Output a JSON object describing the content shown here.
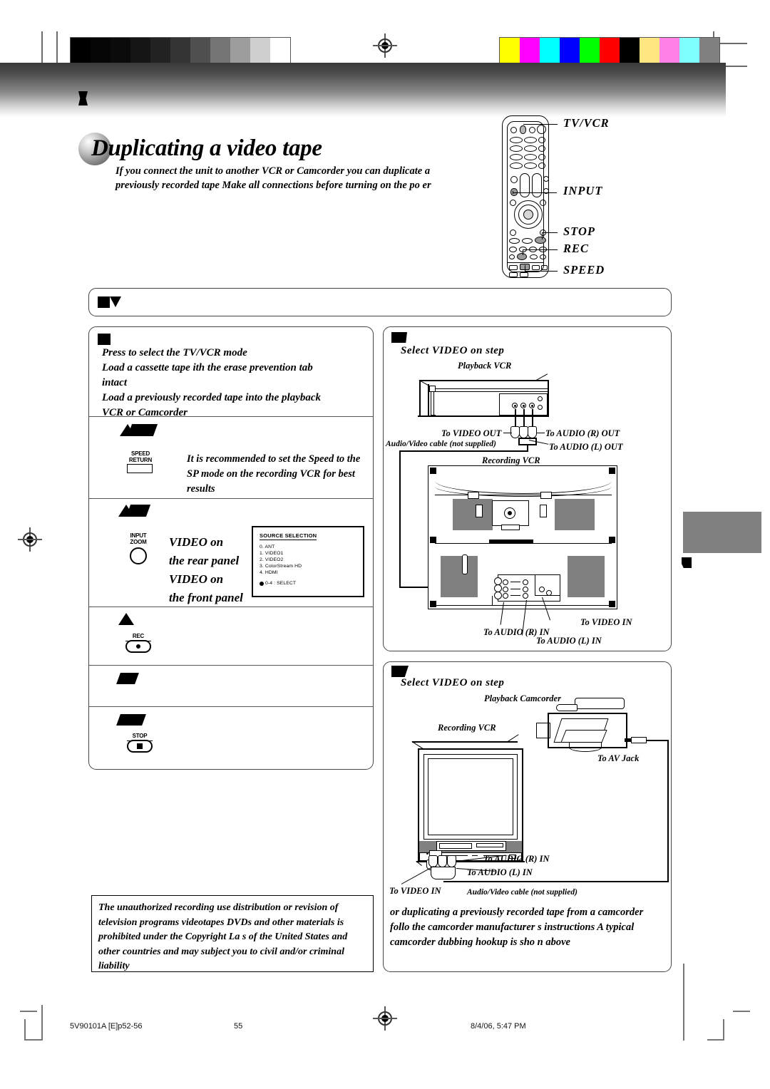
{
  "page": {
    "title": "Duplicating a video tape",
    "lead": "If you connect the unit to another VCR or Camcorder  you can duplicate a previously recorded tape  Make all connections before turning on the po  er"
  },
  "remote": {
    "callouts": [
      {
        "label": "TV/VCR"
      },
      {
        "label": "INPUT"
      },
      {
        "label": "STOP"
      },
      {
        "label": "REC"
      },
      {
        "label": "SPEED"
      }
    ]
  },
  "steps": {
    "step1": {
      "lines": [
        "Press            to select the TV/VCR mode",
        "Load a cassette tape   ith the erase prevention tab",
        "intact",
        "Load a previously recorded tape into the playback",
        "VCR or Camcorder"
      ]
    },
    "step2": {
      "key_label_line1": "SPEED",
      "key_label_line2": "RETURN",
      "text": "It is recommended to set the Speed to the SP mode on the recording VCR for best results"
    },
    "step3": {
      "key_label_line1": "INPUT",
      "key_label_line2": "ZOOM",
      "lines": [
        "VIDEO    on",
        "the rear panel",
        "VIDEO    on",
        "the front panel"
      ],
      "osd": {
        "title": "SOURCE SELECTION",
        "items": [
          "0.  ANT",
          "1.  VIDEO1",
          "2.  VIDEO2",
          "3.  ColorStream HD",
          "4.  HDMI"
        ],
        "footer": "0-4 : SELECT"
      }
    },
    "step4": {
      "key_label": "REC"
    },
    "step5": {
      "key_label": ""
    },
    "step6": {
      "key_label": "STOP"
    }
  },
  "copyright_notice": "The unauthorized recording  use  distribution  or revision of television programs  videotapes  DVDs and other materials is prohibited under the Copyright La  s of the United States and other countries  and may subject you to civil and/or criminal liability",
  "diagram_vcr": {
    "heading": "Select  VIDEO     on step",
    "playback_label": "Playback VCR",
    "recording_label": "Recording VCR",
    "cable_label": "Audio/Video cable (not supplied)",
    "to_video_out": "To VIDEO OUT",
    "to_audio_r_out": "To AUDIO (R) OUT",
    "to_audio_l_out": "To AUDIO (L) OUT",
    "to_video_in": "To VIDEO IN",
    "to_audio_r_in": "To AUDIO (R) IN",
    "to_audio_l_in": "To AUDIO (L) IN"
  },
  "diagram_camcorder": {
    "heading": "Select  VIDEO     on step",
    "playback_label": "Playback Camcorder",
    "recording_label": "Recording VCR",
    "to_av_jack": "To AV Jack",
    "to_video_in": "To VIDEO IN",
    "to_audio_r_in": "To AUDIO (R) IN",
    "to_audio_l_in": "To AUDIO (L) IN",
    "cable_label": "Audio/Video cable (not supplied)",
    "note": "or duplicating a previously recorded tape from a camcorder  follo   the camcorder manufacturer s instructions  A typical camcorder dubbing hookup is sho  n above"
  },
  "footer": {
    "doc_id": "5V90101A [E]p52-56",
    "page_number": "55",
    "timestamp": "8/4/06, 5:47 PM"
  },
  "colorbars": {
    "grayscale": [
      "#000000",
      "#050505",
      "#0b0b0b",
      "#151515",
      "#222222",
      "#343434",
      "#4f4f4f",
      "#757575",
      "#9d9d9d",
      "#cfcfcf",
      "#ffffff"
    ],
    "chroma": [
      "#ffff00",
      "#ff00ff",
      "#00ffff",
      "#0000ff",
      "#00ff00",
      "#ff0000",
      "#000000",
      "#ffe680",
      "#ff80e6",
      "#80ffff",
      "#808080"
    ]
  }
}
